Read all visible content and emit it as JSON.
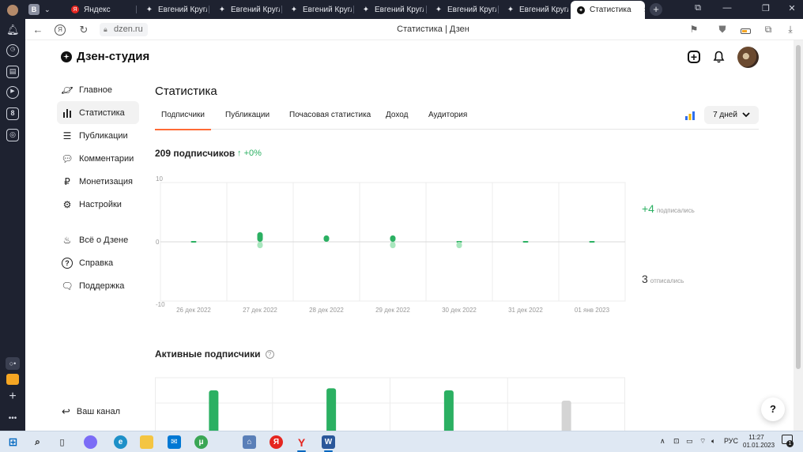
{
  "browser": {
    "tabs": [
      {
        "label": "Яндекс",
        "icon": "yandex-icon"
      },
      {
        "label": "Евгений Кругло",
        "icon": "zen-star-icon"
      },
      {
        "label": "Евгений Кругло",
        "icon": "zen-star-icon"
      },
      {
        "label": "Евгений Кругло",
        "icon": "zen-star-icon"
      },
      {
        "label": "Евгений Кругло",
        "icon": "zen-star-icon"
      },
      {
        "label": "Евгений Кругло",
        "icon": "zen-star-icon"
      },
      {
        "label": "Евгений Кругло",
        "icon": "zen-star-icon"
      }
    ],
    "active_tab": {
      "label": "Статистика",
      "icon": "zen-logo-icon"
    },
    "address": {
      "url": "dzen.ru",
      "page_title": "Статистика | Дзен"
    }
  },
  "sidebar": {
    "logo": "Дзен-студия",
    "items": [
      {
        "label": "Главное",
        "icon": "planet-icon"
      },
      {
        "label": "Статистика",
        "icon": "bar-chart-icon",
        "active": true
      },
      {
        "label": "Публикации",
        "icon": "stack-icon"
      },
      {
        "label": "Комментарии",
        "icon": "comment-icon"
      },
      {
        "label": "Монетизация",
        "icon": "ruble-icon"
      },
      {
        "label": "Настройки",
        "icon": "gear-icon"
      }
    ],
    "secondary": [
      {
        "label": "Всё о Дзене",
        "icon": "flame-icon"
      },
      {
        "label": "Справка",
        "icon": "question-icon"
      },
      {
        "label": "Поддержка",
        "icon": "chat-icon"
      }
    ],
    "your_channel": "Ваш канал"
  },
  "main": {
    "title": "Статистика",
    "tabs": [
      "Подписчики",
      "Публикации",
      "Почасовая статистика",
      "Доход",
      "Аудитория"
    ],
    "active_tab": "Подписчики",
    "period": "7 дней",
    "subscribers_label": "209 подписчиков",
    "subscribers_delta": "+0%",
    "stats": {
      "subscribed_value": "+4",
      "subscribed_label": "подписались",
      "unsubscribed_value": "3",
      "unsubscribed_label": "отписались"
    },
    "active_title": "Активные подписчики"
  },
  "chart_data": [
    {
      "type": "bar",
      "title": "",
      "categories": [
        "26 дек 2022",
        "27 дек 2022",
        "28 дек 2022",
        "29 дек 2022",
        "30 дек 2022",
        "31 дек 2022",
        "01 янв 2023"
      ],
      "y_ticks": [
        "10",
        "0",
        "-10"
      ],
      "ylim": [
        -10,
        10
      ],
      "series": [
        {
          "name": "подписались",
          "values": [
            0,
            2,
            1,
            1,
            0,
            0,
            0
          ],
          "color": "#2bb062"
        },
        {
          "name": "отписались",
          "values": [
            0,
            -1,
            0,
            -1,
            -1,
            0,
            0
          ],
          "color": "#a8e6bd"
        }
      ],
      "grid": true
    },
    {
      "type": "bar",
      "title": "Активные подписчики",
      "values": [
        1,
        1.05,
        1,
        0.75
      ],
      "colors": [
        "#2bb062",
        "#2bb062",
        "#2bb062",
        "#d4d4d4"
      ],
      "grid": true
    }
  ],
  "taskbar": {
    "lang": "РУС",
    "time": "11:27",
    "date": "01.01.2023",
    "notifications": "1"
  },
  "colors": {
    "accent": "#ff6b35",
    "positive": "#2bb062",
    "rail": "#1e2230"
  }
}
